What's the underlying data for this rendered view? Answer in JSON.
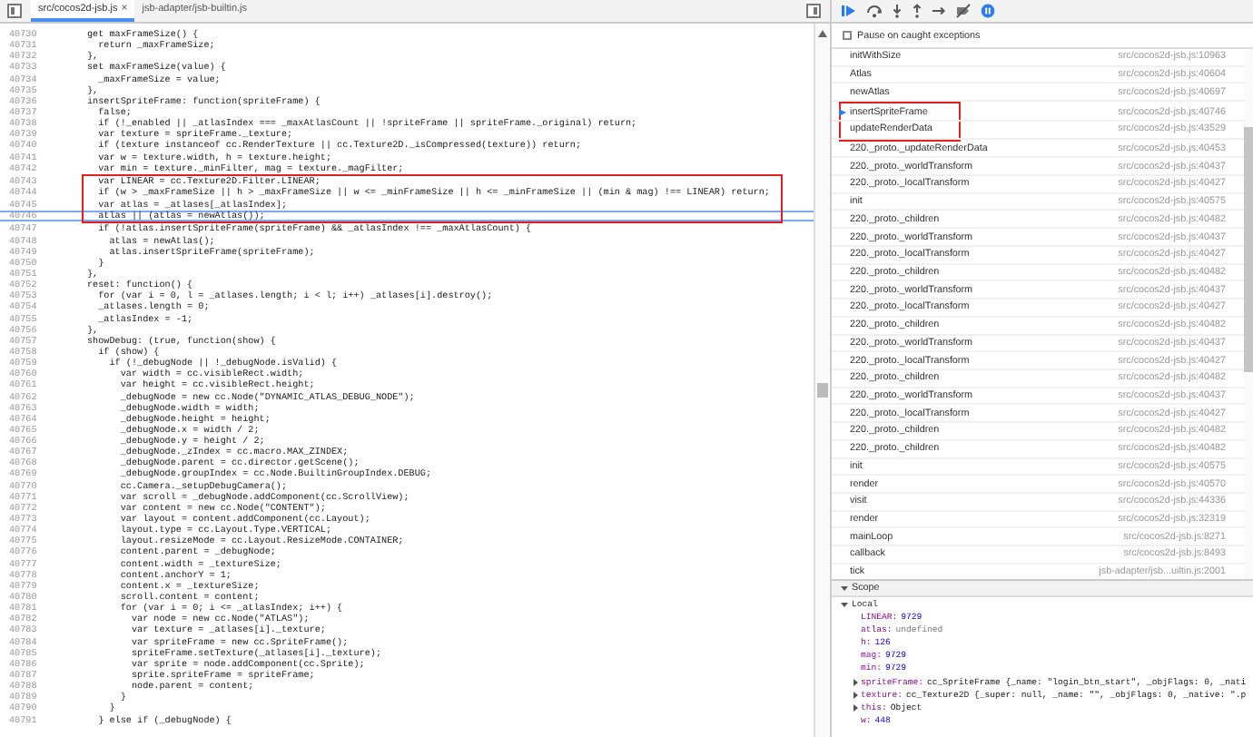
{
  "editor_tabs": [
    {
      "label": "src/cocos2d-jsb.js",
      "close_label": "×",
      "selected": true
    },
    {
      "label": "jsb-adapter/jsb-builtin.js",
      "selected": false
    }
  ],
  "code": {
    "lines": [
      {
        "number": "40730",
        "text": "get maxFrameSize() {",
        "current": false,
        "boxed": false
      },
      {
        "number": "40731",
        "text": "  return _maxFrameSize;",
        "current": false,
        "boxed": false
      },
      {
        "number": "40732",
        "text": "},",
        "current": false,
        "boxed": false
      },
      {
        "number": "40733",
        "text": "set maxFrameSize(value) {",
        "current": false,
        "boxed": false
      },
      {
        "number": "40734",
        "text": "  _maxFrameSize = value;",
        "current": false,
        "boxed": false
      },
      {
        "number": "40735",
        "text": "},",
        "current": false,
        "boxed": false
      },
      {
        "number": "40736",
        "text": "insertSpriteFrame: function(spriteFrame) {",
        "current": false,
        "boxed": false
      },
      {
        "number": "40737",
        "text": "  false;",
        "current": false,
        "boxed": false
      },
      {
        "number": "40738",
        "text": "  if (!_enabled || _atlasIndex === _maxAtlasCount || !spriteFrame || spriteFrame._original) return;",
        "current": false,
        "boxed": false
      },
      {
        "number": "40739",
        "text": "  var texture = spriteFrame._texture;",
        "current": false,
        "boxed": false
      },
      {
        "number": "40740",
        "text": "  if (texture instanceof cc.RenderTexture || cc.Texture2D._isCompressed(texture)) return;",
        "current": false,
        "boxed": false
      },
      {
        "number": "40741",
        "text": "  var w = texture.width, h = texture.height;",
        "current": false,
        "boxed": false
      },
      {
        "number": "40742",
        "text": "  var min = texture._minFilter, mag = texture._magFilter;",
        "current": false,
        "boxed": false
      },
      {
        "number": "40743",
        "text": "  var LINEAR = cc.Texture2D.Filter.LINEAR;",
        "current": false,
        "boxed": true
      },
      {
        "number": "40744",
        "text": "  if (w > _maxFrameSize || h > _maxFrameSize || w <= _minFrameSize || h <= _minFrameSize || (min & mag) !== LINEAR) return;",
        "current": false,
        "boxed": true
      },
      {
        "number": "40745",
        "text": "  var atlas = _atlases[_atlasIndex];",
        "current": false,
        "boxed": true
      },
      {
        "number": "40746",
        "text": "  atlas || (atlas = newAtlas());",
        "current": true,
        "boxed": true
      },
      {
        "number": "40747",
        "text": "  if (!atlas.insertSpriteFrame(spriteFrame) && _atlasIndex !== _maxAtlasCount) {",
        "current": false,
        "boxed": false
      },
      {
        "number": "40748",
        "text": "    atlas = newAtlas();",
        "current": false,
        "boxed": false
      },
      {
        "number": "40749",
        "text": "    atlas.insertSpriteFrame(spriteFrame);",
        "current": false,
        "boxed": false
      },
      {
        "number": "40750",
        "text": "  }",
        "current": false,
        "boxed": false
      },
      {
        "number": "40751",
        "text": "},",
        "current": false,
        "boxed": false
      },
      {
        "number": "40752",
        "text": "reset: function() {",
        "current": false,
        "boxed": false
      },
      {
        "number": "40753",
        "text": "  for (var i = 0, l = _atlases.length; i < l; i++) _atlases[i].destroy();",
        "current": false,
        "boxed": false
      },
      {
        "number": "40754",
        "text": "  _atlases.length = 0;",
        "current": false,
        "boxed": false
      },
      {
        "number": "40755",
        "text": "  _atlasIndex = -1;",
        "current": false,
        "boxed": false
      },
      {
        "number": "40756",
        "text": "},",
        "current": false,
        "boxed": false
      },
      {
        "number": "40757",
        "text": "showDebug: (true, function(show) {",
        "current": false,
        "boxed": false
      },
      {
        "number": "40758",
        "text": "  if (show) {",
        "current": false,
        "boxed": false
      },
      {
        "number": "40759",
        "text": "    if (!_debugNode || !_debugNode.isValid) {",
        "current": false,
        "boxed": false
      },
      {
        "number": "40760",
        "text": "      var width = cc.visibleRect.width;",
        "current": false,
        "boxed": false
      },
      {
        "number": "40761",
        "text": "      var height = cc.visibleRect.height;",
        "current": false,
        "boxed": false
      },
      {
        "number": "40762",
        "text": "      _debugNode = new cc.Node(\"DYNAMIC_ATLAS_DEBUG_NODE\");",
        "current": false,
        "boxed": false
      },
      {
        "number": "40763",
        "text": "      _debugNode.width = width;",
        "current": false,
        "boxed": false
      },
      {
        "number": "40764",
        "text": "      _debugNode.height = height;",
        "current": false,
        "boxed": false
      },
      {
        "number": "40765",
        "text": "      _debugNode.x = width / 2;",
        "current": false,
        "boxed": false
      },
      {
        "number": "40766",
        "text": "      _debugNode.y = height / 2;",
        "current": false,
        "boxed": false
      },
      {
        "number": "40767",
        "text": "      _debugNode._zIndex = cc.macro.MAX_ZINDEX;",
        "current": false,
        "boxed": false
      },
      {
        "number": "40768",
        "text": "      _debugNode.parent = cc.director.getScene();",
        "current": false,
        "boxed": false
      },
      {
        "number": "40769",
        "text": "      _debugNode.groupIndex = cc.Node.BuiltinGroupIndex.DEBUG;",
        "current": false,
        "boxed": false
      },
      {
        "number": "40770",
        "text": "      cc.Camera._setupDebugCamera();",
        "current": false,
        "boxed": false
      },
      {
        "number": "40771",
        "text": "      var scroll = _debugNode.addComponent(cc.ScrollView);",
        "current": false,
        "boxed": false
      },
      {
        "number": "40772",
        "text": "      var content = new cc.Node(\"CONTENT\");",
        "current": false,
        "boxed": false
      },
      {
        "number": "40773",
        "text": "      var layout = content.addComponent(cc.Layout);",
        "current": false,
        "boxed": false
      },
      {
        "number": "40774",
        "text": "      layout.type = cc.Layout.Type.VERTICAL;",
        "current": false,
        "boxed": false
      },
      {
        "number": "40775",
        "text": "      layout.resizeMode = cc.Layout.ResizeMode.CONTAINER;",
        "current": false,
        "boxed": false
      },
      {
        "number": "40776",
        "text": "      content.parent = _debugNode;",
        "current": false,
        "boxed": false
      },
      {
        "number": "40777",
        "text": "      content.width = _textureSize;",
        "current": false,
        "boxed": false
      },
      {
        "number": "40778",
        "text": "      content.anchorY = 1;",
        "current": false,
        "boxed": false
      },
      {
        "number": "40779",
        "text": "      content.x = _textureSize;",
        "current": false,
        "boxed": false
      },
      {
        "number": "40780",
        "text": "      scroll.content = content;",
        "current": false,
        "boxed": false
      },
      {
        "number": "40781",
        "text": "      for (var i = 0; i <= _atlasIndex; i++) {",
        "current": false,
        "boxed": false
      },
      {
        "number": "40782",
        "text": "        var node = new cc.Node(\"ATLAS\");",
        "current": false,
        "boxed": false
      },
      {
        "number": "40783",
        "text": "        var texture = _atlases[i]._texture;",
        "current": false,
        "boxed": false
      },
      {
        "number": "40784",
        "text": "        var spriteFrame = new cc.SpriteFrame();",
        "current": false,
        "boxed": false
      },
      {
        "number": "40785",
        "text": "        spriteFrame.setTexture(_atlases[i]._texture);",
        "current": false,
        "boxed": false
      },
      {
        "number": "40786",
        "text": "        var sprite = node.addComponent(cc.Sprite);",
        "current": false,
        "boxed": false
      },
      {
        "number": "40787",
        "text": "        sprite.spriteFrame = spriteFrame;",
        "current": false,
        "boxed": false
      },
      {
        "number": "40788",
        "text": "        node.parent = content;",
        "current": false,
        "boxed": false
      },
      {
        "number": "40789",
        "text": "      }",
        "current": false,
        "boxed": false
      },
      {
        "number": "40790",
        "text": "    }",
        "current": false,
        "boxed": false
      },
      {
        "number": "40791",
        "text": "  } else if (_debugNode) {",
        "current": false,
        "boxed": false
      }
    ]
  },
  "debugger": {
    "pause_on_caught_exceptions": {
      "label": "Pause on caught exceptions",
      "checked": false
    },
    "call_stack": [
      {
        "function": "initWithSize",
        "location": "src/cocos2d-jsb.js:10963",
        "selected": false,
        "boxed": false
      },
      {
        "function": "Atlas",
        "location": "src/cocos2d-jsb.js:40604",
        "selected": false,
        "boxed": false
      },
      {
        "function": "newAtlas",
        "location": "src/cocos2d-jsb.js:40697",
        "selected": false,
        "boxed": false
      },
      {
        "function": "insertSpriteFrame",
        "location": "src/cocos2d-jsb.js:40746",
        "selected": true,
        "boxed": true
      },
      {
        "function": "updateRenderData",
        "location": "src/cocos2d-jsb.js:43529",
        "selected": false,
        "boxed": true
      },
      {
        "function": "220._proto._updateRenderData",
        "location": "src/cocos2d-jsb.js:40453",
        "selected": false,
        "boxed": false
      },
      {
        "function": "220._proto._worldTransform",
        "location": "src/cocos2d-jsb.js:40437",
        "selected": false,
        "boxed": false
      },
      {
        "function": "220._proto._localTransform",
        "location": "src/cocos2d-jsb.js:40427",
        "selected": false,
        "boxed": false
      },
      {
        "function": "init",
        "location": "src/cocos2d-jsb.js:40575",
        "selected": false,
        "boxed": false
      },
      {
        "function": "220._proto._children",
        "location": "src/cocos2d-jsb.js:40482",
        "selected": false,
        "boxed": false
      },
      {
        "function": "220._proto._worldTransform",
        "location": "src/cocos2d-jsb.js:40437",
        "selected": false,
        "boxed": false
      },
      {
        "function": "220._proto._localTransform",
        "location": "src/cocos2d-jsb.js:40427",
        "selected": false,
        "boxed": false
      },
      {
        "function": "220._proto._children",
        "location": "src/cocos2d-jsb.js:40482",
        "selected": false,
        "boxed": false
      },
      {
        "function": "220._proto._worldTransform",
        "location": "src/cocos2d-jsb.js:40437",
        "selected": false,
        "boxed": false
      },
      {
        "function": "220._proto._localTransform",
        "location": "src/cocos2d-jsb.js:40427",
        "selected": false,
        "boxed": false
      },
      {
        "function": "220._proto._children",
        "location": "src/cocos2d-jsb.js:40482",
        "selected": false,
        "boxed": false
      },
      {
        "function": "220._proto._worldTransform",
        "location": "src/cocos2d-jsb.js:40437",
        "selected": false,
        "boxed": false
      },
      {
        "function": "220._proto._localTransform",
        "location": "src/cocos2d-jsb.js:40427",
        "selected": false,
        "boxed": false
      },
      {
        "function": "220._proto._children",
        "location": "src/cocos2d-jsb.js:40482",
        "selected": false,
        "boxed": false
      },
      {
        "function": "220._proto._worldTransform",
        "location": "src/cocos2d-jsb.js:40437",
        "selected": false,
        "boxed": false
      },
      {
        "function": "220._proto._localTransform",
        "location": "src/cocos2d-jsb.js:40427",
        "selected": false,
        "boxed": false
      },
      {
        "function": "220._proto._children",
        "location": "src/cocos2d-jsb.js:40482",
        "selected": false,
        "boxed": false
      },
      {
        "function": "220._proto._children",
        "location": "src/cocos2d-jsb.js:40482",
        "selected": false,
        "boxed": false
      },
      {
        "function": "init",
        "location": "src/cocos2d-jsb.js:40575",
        "selected": false,
        "boxed": false
      },
      {
        "function": "render",
        "location": "src/cocos2d-jsb.js:40570",
        "selected": false,
        "boxed": false
      },
      {
        "function": "visit",
        "location": "src/cocos2d-jsb.js:44336",
        "selected": false,
        "boxed": false
      },
      {
        "function": "render",
        "location": "src/cocos2d-jsb.js:32319",
        "selected": false,
        "boxed": false
      },
      {
        "function": "mainLoop",
        "location": "src/cocos2d-jsb.js:8271",
        "selected": false,
        "boxed": false
      },
      {
        "function": "callback",
        "location": "src/cocos2d-jsb.js:8493",
        "selected": false,
        "boxed": false
      },
      {
        "function": "tick",
        "location": "jsb-adapter/jsb...uiltin.js:2001",
        "selected": false,
        "boxed": false
      }
    ],
    "scope": {
      "label": "Scope",
      "expanded": true,
      "local": {
        "label": "Local",
        "expanded": true,
        "variables": [
          {
            "name": "LINEAR:",
            "value": "9729",
            "kind": "number",
            "expandable": false
          },
          {
            "name": "atlas:",
            "value": "undefined",
            "kind": "undefined",
            "expandable": false
          },
          {
            "name": "h:",
            "value": "126",
            "kind": "number",
            "expandable": false
          },
          {
            "name": "mag:",
            "value": "9729",
            "kind": "number",
            "expandable": false
          },
          {
            "name": "min:",
            "value": "9729",
            "kind": "number",
            "expandable": false
          },
          {
            "name": "spriteFrame:",
            "value": "cc_SpriteFrame {_name: \"login_btn_start\", _objFlags: 0, _nati",
            "kind": "object",
            "expandable": true
          },
          {
            "name": "texture:",
            "value": "cc_Texture2D {_super: null, _name: \"\", _objFlags: 0, _native: \".p",
            "kind": "object",
            "expandable": true
          },
          {
            "name": "this:",
            "value": "Object",
            "kind": "object",
            "expandable": true
          },
          {
            "name": "w:",
            "value": "448",
            "kind": "number",
            "expandable": false
          }
        ]
      }
    }
  }
}
